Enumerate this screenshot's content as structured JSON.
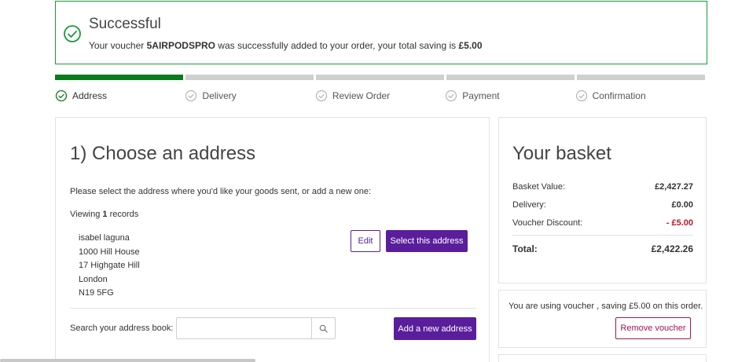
{
  "alert": {
    "title": "Successful",
    "msg_prefix": "Your voucher ",
    "voucher_code": "5AIRPODSPRO",
    "msg_middle": " was successfully added to your order, your total saving is ",
    "saving": "£5.00",
    "color": "#1a9c3a"
  },
  "progress": {
    "steps": [
      {
        "label": "Address",
        "status": "done"
      },
      {
        "label": "Delivery",
        "status": "pending"
      },
      {
        "label": "Review Order",
        "status": "pending"
      },
      {
        "label": "Payment",
        "status": "pending"
      },
      {
        "label": "Confirmation",
        "status": "pending"
      }
    ],
    "done_color": "#0d7a1d",
    "pending_color": "#d0d0d0"
  },
  "address_section": {
    "title": "1) Choose an address",
    "instructions": "Please select the address where you'd like your goods sent, or add a new one:",
    "viewing_prefix": "Viewing ",
    "viewing_count": "1",
    "viewing_suffix": " records",
    "address": {
      "line1": "isabel laguna",
      "line2": "1000 Hill House",
      "line3": "17 Highgate Hill",
      "line4": "London",
      "line5": "N19 5FG"
    },
    "edit_label": "Edit",
    "select_label": "Select this address",
    "search_label": "Search your address book:",
    "search_value": "",
    "add_label": "Add a new address",
    "accent_color": "#5a1e9c"
  },
  "basket": {
    "title": "Your basket",
    "rows": [
      {
        "label": "Basket Value:",
        "value": "£2,427.27"
      },
      {
        "label": "Delivery:",
        "value": "£0.00"
      },
      {
        "label": "Voucher Discount:",
        "value": "- £5.00"
      }
    ],
    "total_label": "Total:",
    "total_value": "£2,422.26",
    "discount_color": "#c0142b"
  },
  "voucher": {
    "message": "You are using voucher , saving £5.00 on this order.",
    "remove_label": "Remove voucher",
    "remove_color": "#a3164f"
  }
}
